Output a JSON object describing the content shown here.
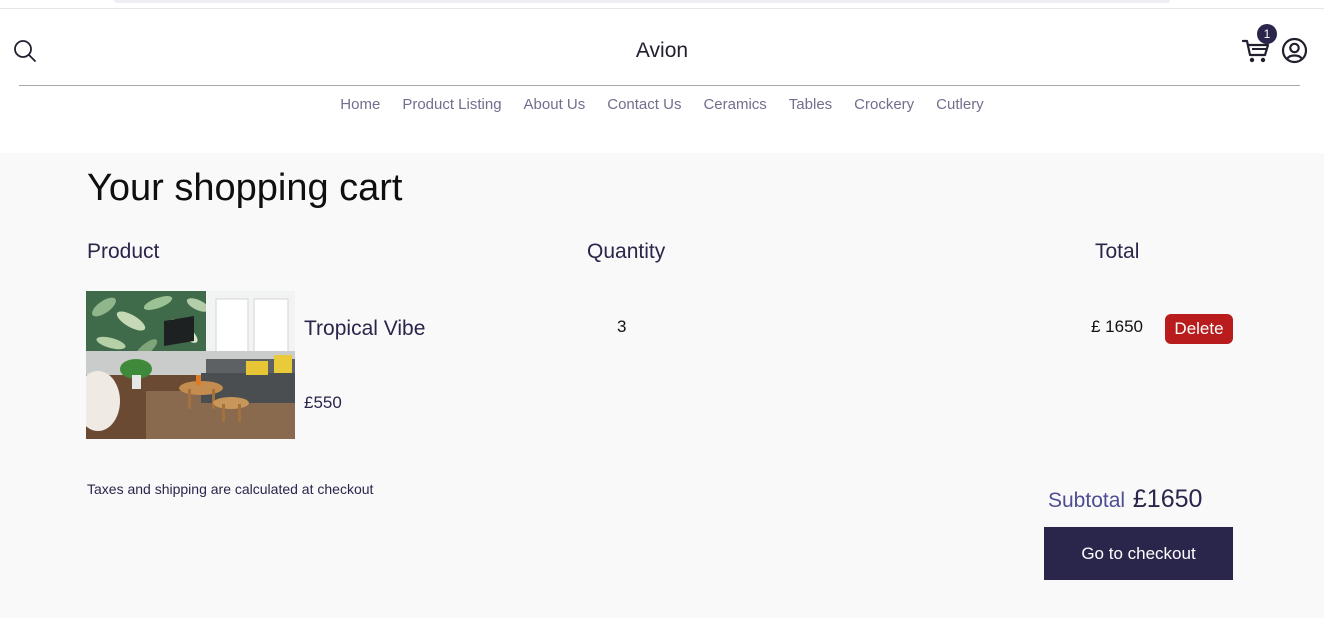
{
  "header": {
    "brand": "Avion",
    "cart_count": "1",
    "nav": [
      "Home",
      "Product Listing",
      "About Us",
      "Contact Us",
      "Ceramics",
      "Tables",
      "Crockery",
      "Cutlery"
    ]
  },
  "cart": {
    "title": "Your shopping cart",
    "columns": {
      "product": "Product",
      "quantity": "Quantity",
      "total": "Total"
    },
    "items": [
      {
        "name": "Tropical Vibe",
        "price": "£550",
        "quantity": "3",
        "total": "£ 1650",
        "delete_label": "Delete"
      }
    ],
    "tax_note": "Taxes and shipping are calculated at checkout",
    "subtotal_label": "Subtotal",
    "subtotal_value": "£1650",
    "checkout_label": "Go to checkout"
  },
  "colors": {
    "primary": "#2a254b",
    "danger": "#b91c1c",
    "nav_text": "#726e8d",
    "subtotal_label": "#4e4d93",
    "background": "#f9f9f9"
  }
}
